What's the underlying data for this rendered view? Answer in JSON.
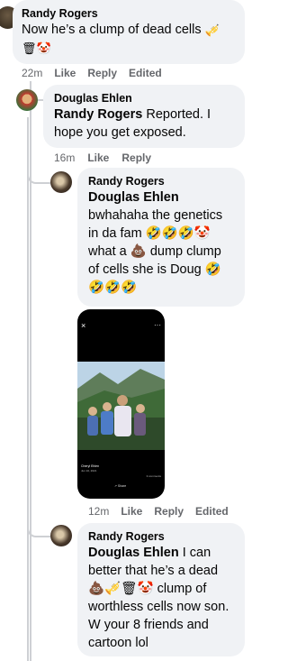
{
  "comments": [
    {
      "author": "Randy Rogers",
      "text": "Now he’s a clump of dead cells",
      "emojis": [
        "🎺",
        "🗑",
        "🤡"
      ],
      "time": "22m",
      "like": "Like",
      "reply": "Reply",
      "edited": "Edited"
    },
    {
      "author": "Douglas Ehlen",
      "mention": "Randy Rogers",
      "text": "Reported. I hope you get exposed.",
      "time": "16m",
      "like": "Like",
      "reply": "Reply"
    },
    {
      "author": "Randy Rogers",
      "mention": "Douglas Ehlen",
      "lines": [
        "bwhahaha the genetics",
        "in da fam 🤣🤣🤣🤡",
        "what a 💩 dump clump",
        "of cells she is Doug 🤣",
        "🤣🤣🤣"
      ],
      "time": "12m",
      "like": "Like",
      "reply": "Reply",
      "edited": "Edited"
    },
    {
      "author": "Randy Rogers",
      "mention": "Douglas Ehlen",
      "lines": [
        "I can",
        "better that he’s a dead",
        "💩🎺🗑🤡 clump of",
        "worthless cells now son.",
        "W your 8 friends and",
        "cartoon lol"
      ]
    }
  ],
  "photo": {
    "more": "···",
    "close": "×",
    "caption_name": "Cheryl Ehlen",
    "caption_date": "Jun 10, 2021",
    "comments": "3 comments",
    "share": "Share"
  }
}
